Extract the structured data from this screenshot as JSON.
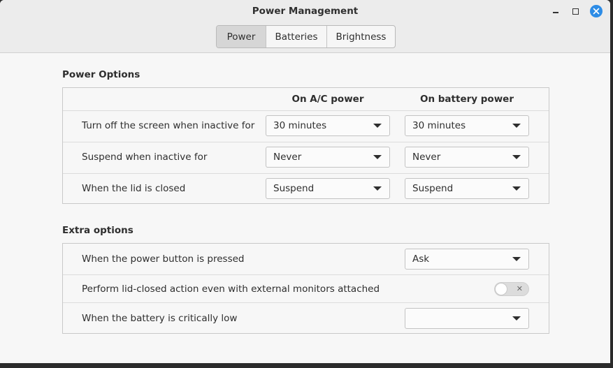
{
  "window": {
    "title": "Power Management"
  },
  "tabs": [
    {
      "label": "Power",
      "active": true
    },
    {
      "label": "Batteries",
      "active": false
    },
    {
      "label": "Brightness",
      "active": false
    }
  ],
  "power_options": {
    "title": "Power Options",
    "col_ac": "On A/C power",
    "col_battery": "On battery power",
    "rows": [
      {
        "label": "Turn off the screen when inactive for",
        "ac": "30 minutes",
        "battery": "30 minutes"
      },
      {
        "label": "Suspend when inactive for",
        "ac": "Never",
        "battery": "Never"
      },
      {
        "label": "When the lid is closed",
        "ac": "Suspend",
        "battery": "Suspend"
      }
    ]
  },
  "extra_options": {
    "title": "Extra options",
    "power_button": {
      "label": "When the power button is pressed",
      "value": "Ask"
    },
    "lid_external": {
      "label": "Perform lid-closed action even with external monitors attached",
      "enabled": false
    },
    "battery_low": {
      "label": "When the battery is critically low",
      "value": ""
    }
  },
  "colors": {
    "accent": "#2d8ce6",
    "window_bg": "#f7f7f7",
    "titlebar_bg": "#ececec"
  }
}
